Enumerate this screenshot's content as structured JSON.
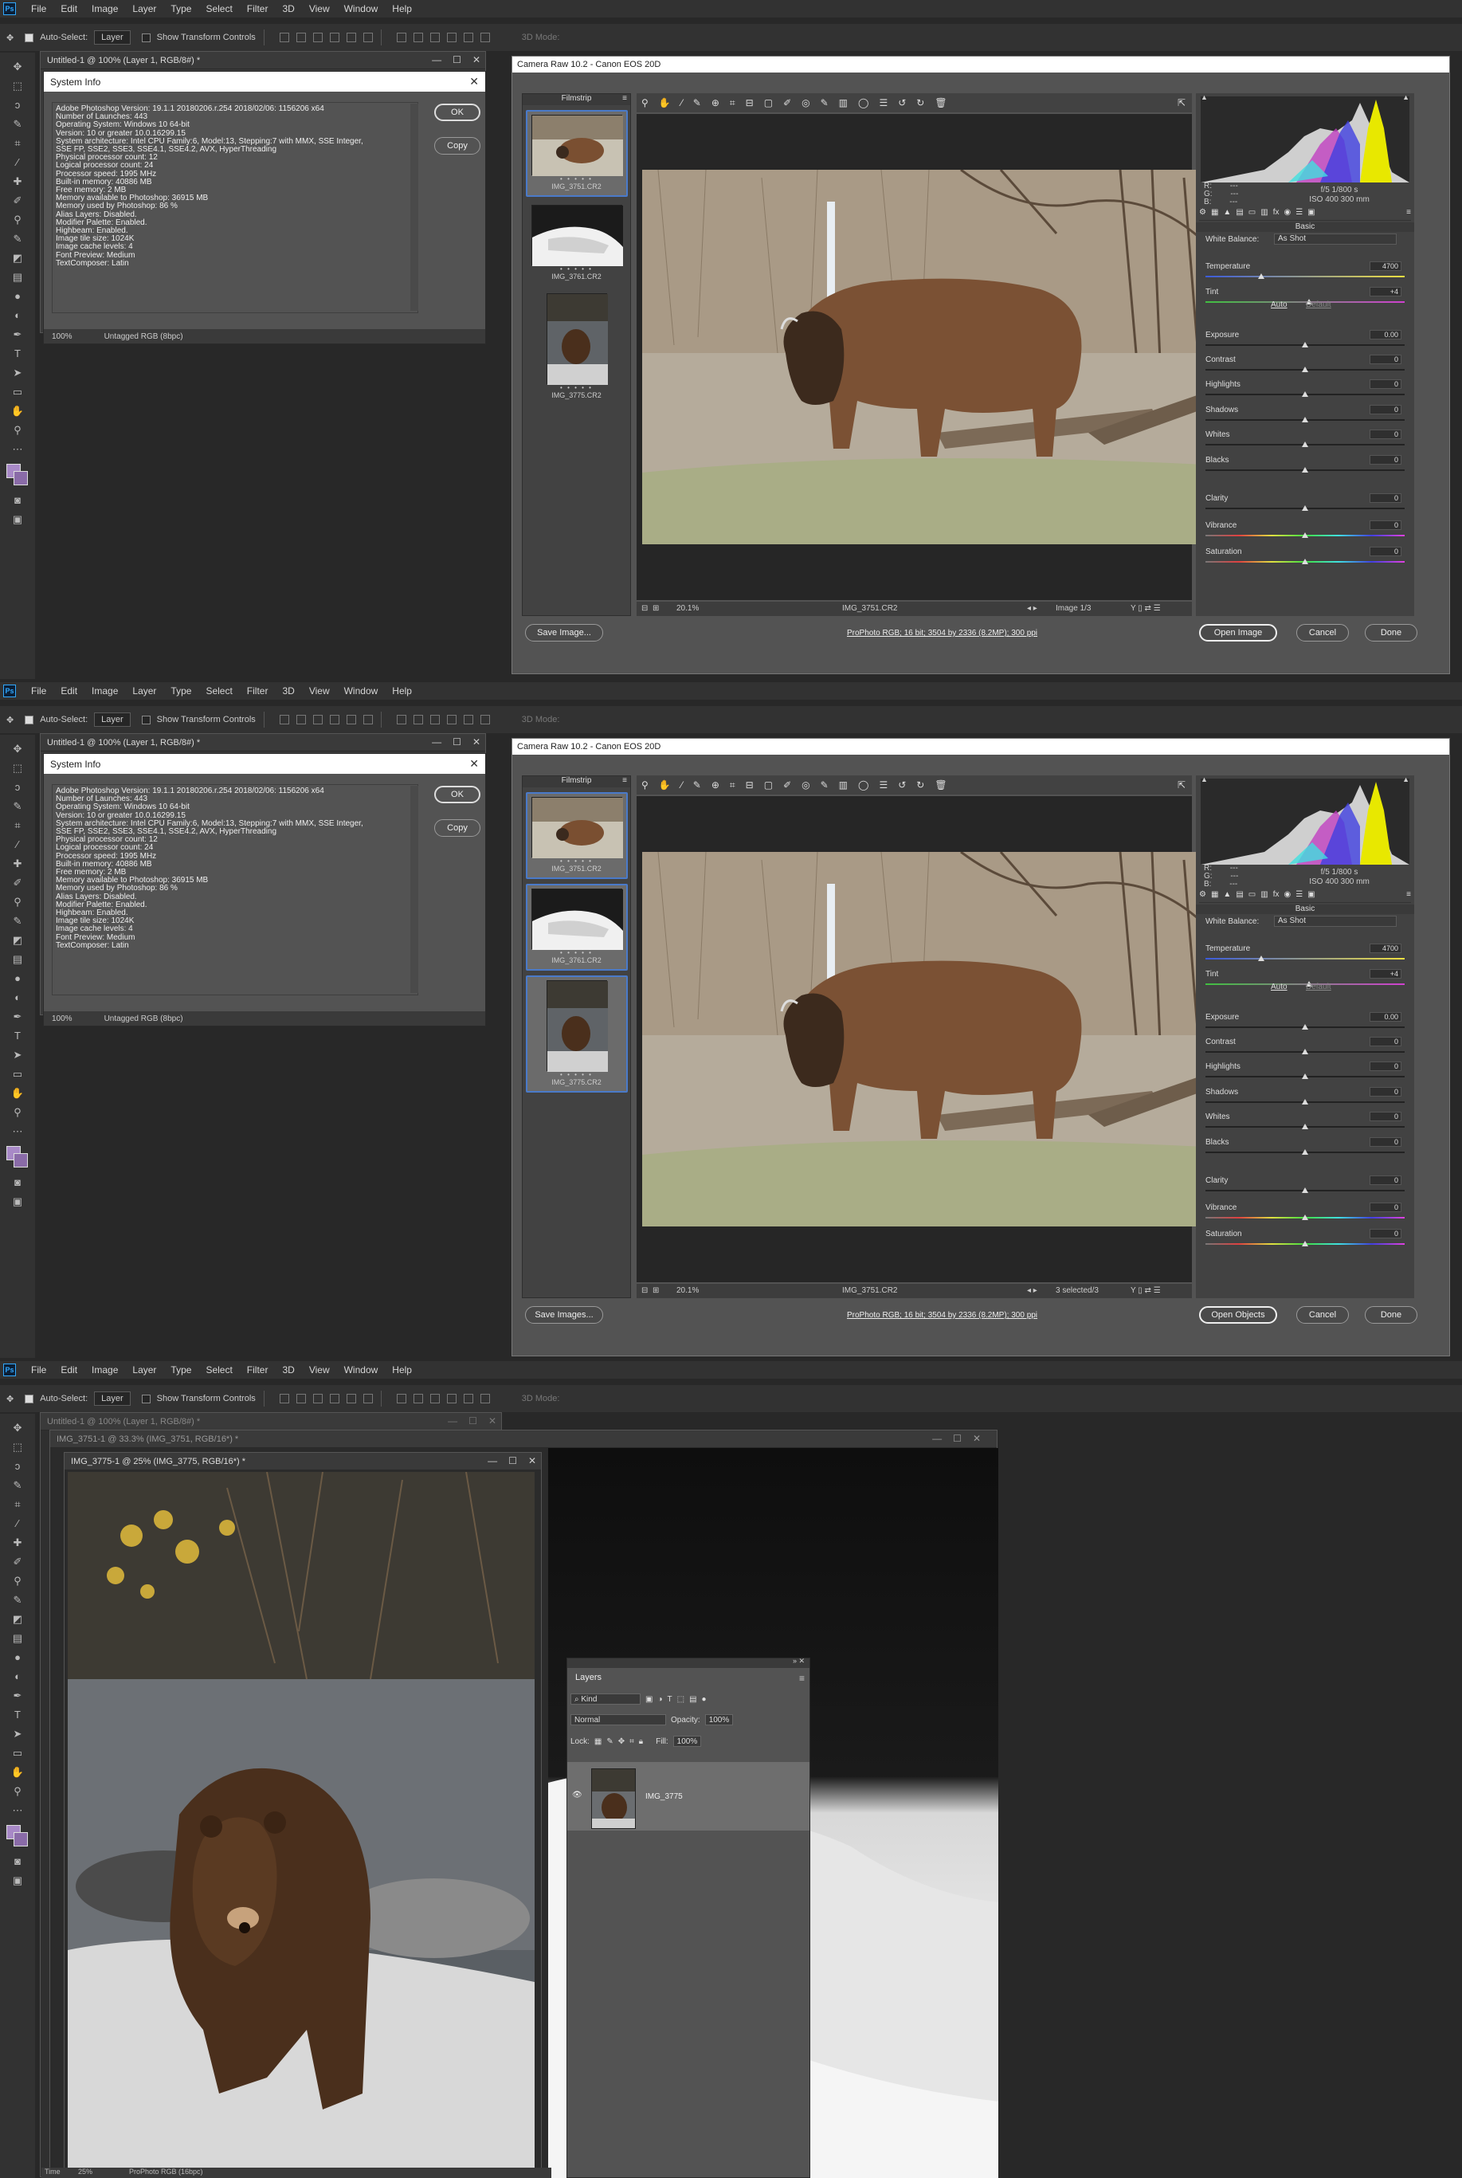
{
  "app": {
    "badge": "Ps"
  },
  "menu": [
    "File",
    "Edit",
    "Image",
    "Layer",
    "Type",
    "Select",
    "Filter",
    "3D",
    "View",
    "Window",
    "Help"
  ],
  "options": {
    "auto_select": "Auto-Select:",
    "layer_value": "Layer",
    "show_transform": "Show Transform Controls",
    "mode_3d": "3D Mode:"
  },
  "doc_untitled": {
    "title": "Untitled-1 @ 100% (Layer 1, RGB/8#) *"
  },
  "sysinfo": {
    "title": "System Info",
    "lines": [
      "Adobe Photoshop Version: 19.1.1 20180206.r.254 2018/02/06: 1156206  x64",
      "Number of Launches: 443",
      "Operating System: Windows 10 64-bit",
      "Version: 10 or greater 10.0.16299.15",
      "System architecture: Intel CPU Family:6, Model:13, Stepping:7 with MMX, SSE Integer,",
      "SSE FP, SSE2, SSE3, SSE4.1, SSE4.2, AVX, HyperThreading",
      "Physical processor count: 12",
      "Logical processor count: 24",
      "Processor speed: 1995 MHz",
      "Built-in memory: 40886 MB",
      "Free memory: 2 MB",
      "Memory available to Photoshop: 36915 MB",
      "Memory used by Photoshop: 86 %",
      "Alias Layers: Disabled.",
      "Modifier Palette: Enabled.",
      "Highbeam: Enabled.",
      "Image tile size: 1024K",
      "Image cache levels: 4",
      "Font Preview: Medium",
      "TextComposer: Latin"
    ],
    "ok": "OK",
    "copy": "Copy",
    "zoom": "100%",
    "profile": "Untagged RGB (8bpc)"
  },
  "camera_raw": {
    "title": "Camera Raw 10.2  -  Canon EOS 20D",
    "filmstrip_label": "Filmstrip",
    "thumbs": [
      "IMG_3751.CR2",
      "IMG_3761.CR2",
      "IMG_3775.CR2"
    ],
    "stars": "• • • • •",
    "zoom": "20.1%",
    "filename": "IMG_3751.CR2",
    "image_count_1": "Image 1/3",
    "image_count_2": "3 selected/3",
    "rgb_labels": [
      "R:",
      "G:",
      "B:"
    ],
    "rgb_values": [
      "---",
      "---",
      "---"
    ],
    "exif_1": "f/5   1/800 s",
    "exif_2": "ISO 400   300 mm",
    "panel_title": "Basic",
    "white_balance_label": "White Balance:",
    "white_balance_value": "As Shot",
    "auto": "Auto",
    "default": "Default",
    "sliders": [
      {
        "label": "Temperature",
        "value": "4700",
        "pos": 0.28
      },
      {
        "label": "Tint",
        "value": "+4",
        "pos": 0.52
      },
      {
        "label": "Exposure",
        "value": "0.00",
        "pos": 0.5
      },
      {
        "label": "Contrast",
        "value": "0",
        "pos": 0.5
      },
      {
        "label": "Highlights",
        "value": "0",
        "pos": 0.5
      },
      {
        "label": "Shadows",
        "value": "0",
        "pos": 0.5
      },
      {
        "label": "Whites",
        "value": "0",
        "pos": 0.5
      },
      {
        "label": "Blacks",
        "value": "0",
        "pos": 0.5
      },
      {
        "label": "Clarity",
        "value": "0",
        "pos": 0.5
      },
      {
        "label": "Vibrance",
        "value": "0",
        "pos": 0.5
      },
      {
        "label": "Saturation",
        "value": "0",
        "pos": 0.5
      }
    ],
    "save_1": "Save Image...",
    "save_2": "Save Images...",
    "open_1": "Open Image",
    "open_2": "Open Objects",
    "cancel": "Cancel",
    "done": "Done",
    "workflow": "ProPhoto RGB; 16 bit; 3504 by 2336 (8.2MP); 300 ppi"
  },
  "docs3": {
    "untitled": "Untitled-1 @ 100% (Layer 1, RGB/8#) *",
    "d3751": "IMG_3751-1 @ 33.3% (IMG_3751, RGB/16*) *",
    "d3775": "IMG_3775-1 @ 25% (IMG_3775, RGB/16*) *",
    "status_zoom": "25%",
    "status_profile": "ProPhoto RGB (16bpc)",
    "timeline": "Time"
  },
  "layers": {
    "tab": "Layers",
    "kind": "⌕ Kind",
    "blend": "Normal",
    "opacity_label": "Opacity:",
    "opacity": "100%",
    "lock_label": "Lock:",
    "fill_label": "Fill:",
    "fill": "100%",
    "layer_name": "IMG_3775"
  }
}
